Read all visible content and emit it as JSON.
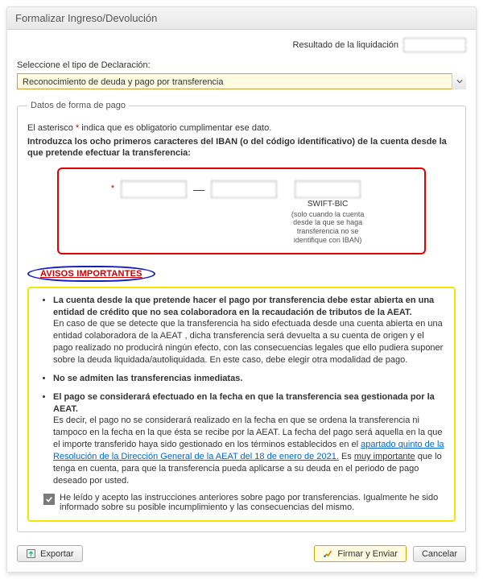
{
  "header": {
    "title": "Formalizar Ingreso/Devolución"
  },
  "result": {
    "label": "Resultado de la liquidación",
    "value": ""
  },
  "declaration": {
    "label": "Seleccione el tipo de Declaración:",
    "selected": "Reconocimiento de deuda y pago por transferencia"
  },
  "payment": {
    "legend": "Datos de forma de pago",
    "required_note_pre": "El asterisco ",
    "required_note_ast": "*",
    "required_note_post": " indica que es obligatorio cumplimentar ese dato.",
    "intro": "Introduzca los ocho primeros caracteres del IBAN (o del código identificativo) de la cuenta desde la que pretende efectuar la transferencia:",
    "iban": {
      "ast": "*",
      "v1": "",
      "v2": "",
      "v3": "",
      "dash": "—",
      "swift_label": "SWIFT-BIC",
      "swift_note": "(solo cuando la cuenta desde la que se haga transferencia no se identifique con IBAN)"
    },
    "avisos": {
      "heading": "AVISOS IMPORTANTES",
      "items": [
        {
          "lead": "La cuenta desde la que pretende hacer el pago por transferencia debe estar abierta en una entidad de crédito que no sea colaboradora en la recaudación de tributos de la AEAT.",
          "body_pre": "En caso de que se detecte que la transferencia ha sido efectuada desde una cuenta abierta en una entidad colaboradora de la AEAT , dicha transferencia será devuelta a  su cuenta de origen y el pago realizado no producirá ningún efecto, con las consecuencias legales que ello pudiera suponer sobre la deuda liquidada/autoliquidada. En este caso, debe elegir otra modalidad de pago.",
          "link_text": "",
          "body_post": ""
        },
        {
          "lead": "No se admiten las transferencias inmediatas.",
          "body_pre": "",
          "link_text": "",
          "body_post": ""
        },
        {
          "lead": "El pago se considerará efectuado en la fecha en que la transferencia sea gestionada por la AEAT.",
          "body_pre": "Es decir, el pago no se considerará realizado en la fecha en que se ordena la transferencia ni tampoco en la fecha en la que ésta se recibe por la AEAT. La fecha del pago será aquella en la que el importe transferido haya sido gestionado en los términos establecidos en el ",
          "link_text": "apartado quinto de la Resolución de la Dirección General de la AEAT del 18 de enero de 2021.",
          "body_post_pre": " Es ",
          "muy": "muy importante",
          "body_post": " que lo tenga en cuenta, para que la transferencia pueda aplicarse a su deuda en el periodo de pago deseado por usted."
        }
      ],
      "ack": "He leído y acepto las instrucciones anteriores sobre pago por transferencias. Igualmente he sido informado sobre su posible incumplimiento y las consecuencias del mismo."
    }
  },
  "footer": {
    "export": "Exportar",
    "sign": "Firmar y Enviar",
    "cancel": "Cancelar"
  }
}
